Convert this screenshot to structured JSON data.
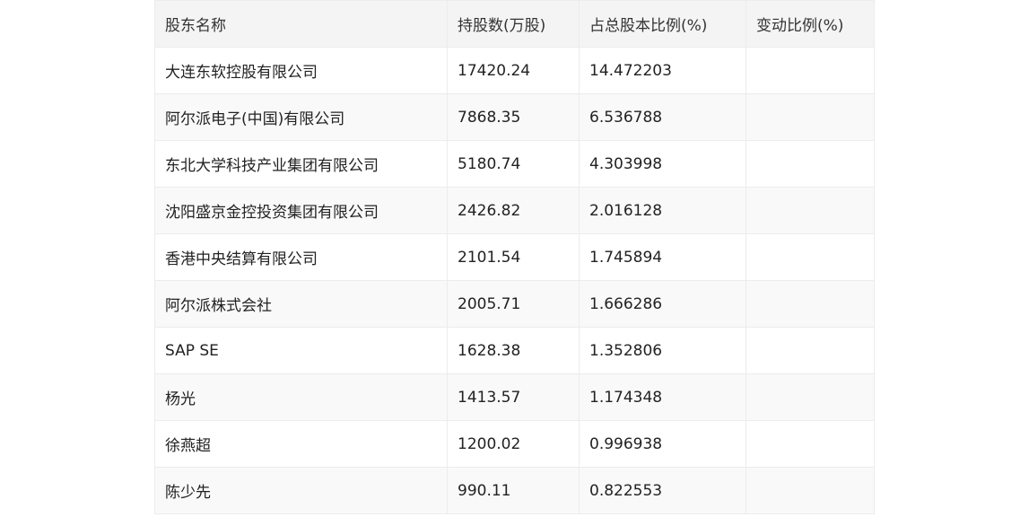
{
  "table": {
    "headers": [
      "股东名称",
      "持股数(万股)",
      "占总股本比例(%)",
      "变动比例(%)"
    ],
    "rows": [
      [
        "大连东软控股有限公司",
        "17420.24",
        "14.472203",
        ""
      ],
      [
        "阿尔派电子(中国)有限公司",
        "7868.35",
        "6.536788",
        ""
      ],
      [
        "东北大学科技产业集团有限公司",
        "5180.74",
        "4.303998",
        ""
      ],
      [
        "沈阳盛京金控投资集团有限公司",
        "2426.82",
        "2.016128",
        ""
      ],
      [
        "香港中央结算有限公司",
        "2101.54",
        "1.745894",
        ""
      ],
      [
        "阿尔派株式会社",
        "2005.71",
        "1.666286",
        ""
      ],
      [
        "SAP SE",
        "1628.38",
        "1.352806",
        ""
      ],
      [
        "杨光",
        "1413.57",
        "1.174348",
        ""
      ],
      [
        "徐燕超",
        "1200.02",
        "0.996938",
        ""
      ],
      [
        "陈少先",
        "990.11",
        "0.822553",
        ""
      ]
    ]
  }
}
